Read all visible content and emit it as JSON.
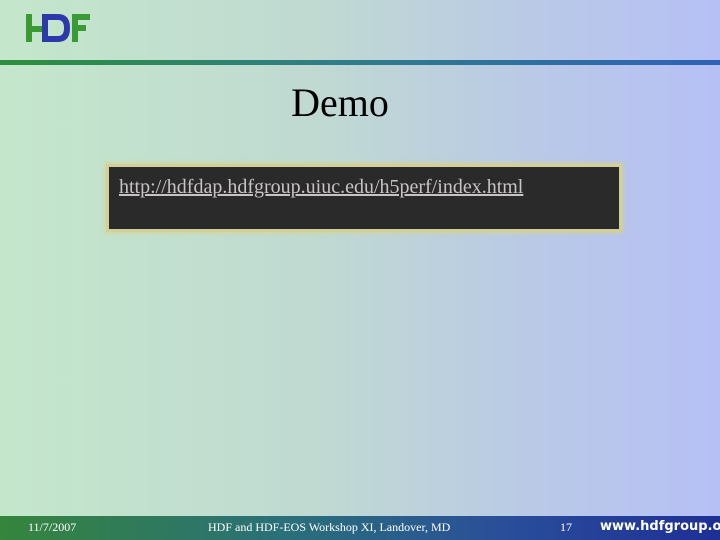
{
  "slide": {
    "logo_text": "HDF",
    "title": "Demo",
    "link": "http://hdfdap.hdfgroup.uiuc.edu/h5perf/index.html"
  },
  "footer": {
    "date": "11/7/2007",
    "event": "HDF and HDF-EOS Workshop XI, Landover, MD",
    "page_number": "17",
    "website": "www.hdfgroup.org"
  },
  "colors": {
    "logo_green": "#3a9a33",
    "logo_blue": "#2b3aa8",
    "link_box_bg": "#2a2a2a",
    "link_text": "#c9c4c4"
  }
}
